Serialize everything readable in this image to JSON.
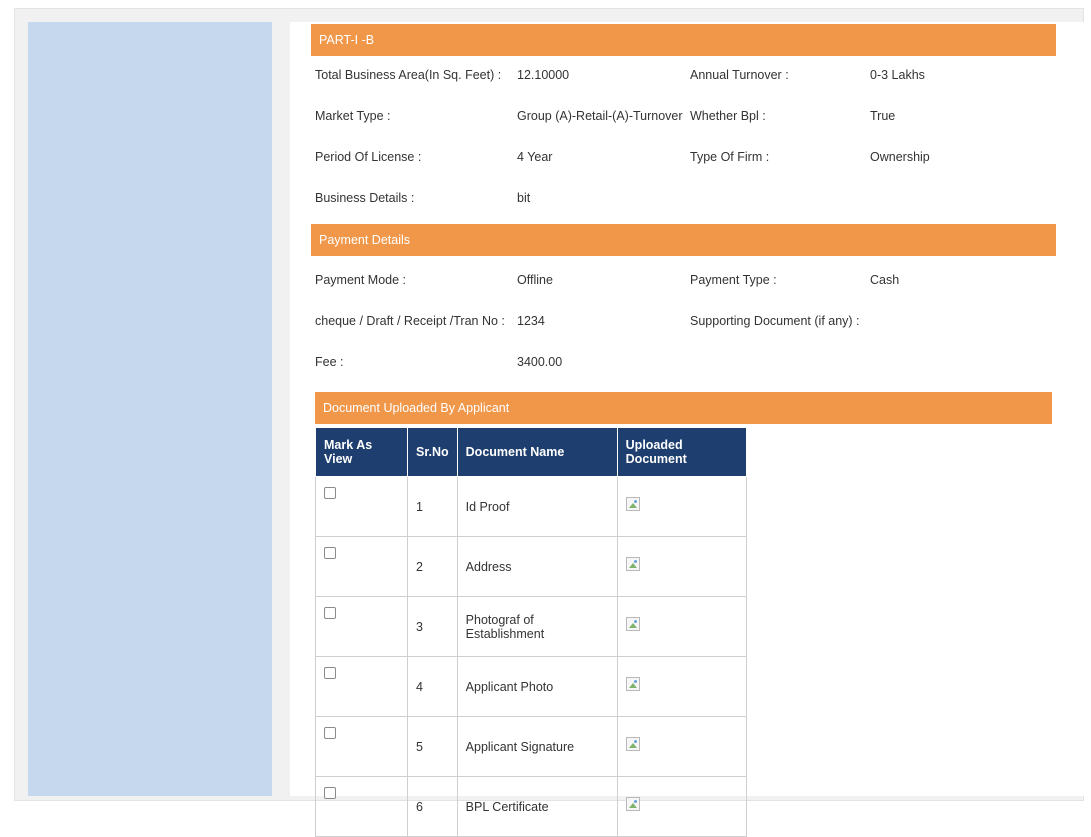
{
  "part1b": {
    "header": "PART-I -B",
    "rows": [
      {
        "label1": "Total Business Area(In Sq. Feet) :",
        "value1": "12.10000",
        "label2": "Annual Turnover :",
        "value2": "0-3 Lakhs"
      },
      {
        "label1": "Market Type :",
        "value1": "Group (A)-Retail-(A)-Turnover",
        "label2": "Whether Bpl :",
        "value2": "True"
      },
      {
        "label1": "Period Of License :",
        "value1": "4 Year",
        "label2": "Type Of Firm :",
        "value2": "Ownership"
      },
      {
        "label1": "Business Details :",
        "value1": "bit",
        "label2": "",
        "value2": ""
      }
    ]
  },
  "payment": {
    "header": "Payment Details",
    "rows": [
      {
        "label1": "Payment Mode :",
        "value1": "Offline",
        "label2": "Payment Type :",
        "value2": "Cash"
      },
      {
        "label1": "cheque / Draft / Receipt /Tran No :",
        "value1": "1234",
        "label2": "Supporting Document (if any) :",
        "value2": ""
      },
      {
        "label1": "Fee :",
        "value1": "3400.00",
        "label2": "",
        "value2": ""
      }
    ]
  },
  "documents": {
    "header": "Document Uploaded By Applicant",
    "columns": [
      "Mark As View",
      "Sr.No",
      "Document Name",
      "Uploaded Document"
    ],
    "rows": [
      {
        "sr": "1",
        "name": "Id Proof"
      },
      {
        "sr": "2",
        "name": "Address"
      },
      {
        "sr": "3",
        "name": "Photograf of Establishment"
      },
      {
        "sr": "4",
        "name": "Applicant Photo"
      },
      {
        "sr": "5",
        "name": "Applicant Signature"
      },
      {
        "sr": "6",
        "name": "BPL Certificate"
      }
    ]
  },
  "colors": {
    "section_header": "#f0974a",
    "table_header": "#1d3e6e",
    "sidebar": "#c5d8ee"
  }
}
